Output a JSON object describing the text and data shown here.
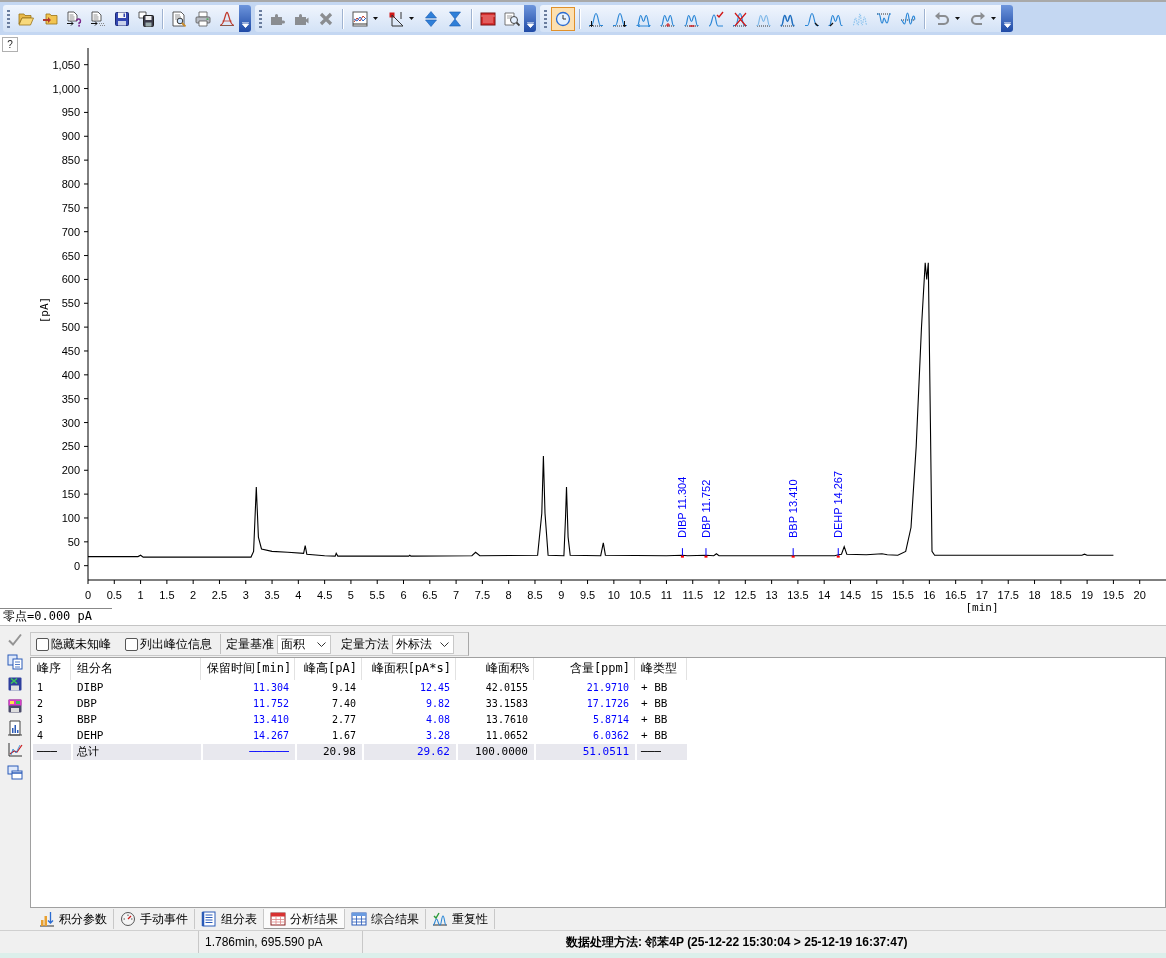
{
  "toolbar": {
    "groups": [
      {
        "sections": [
          {
            "buttons": [
              {
                "kind": "button",
                "disabled": false,
                "selected": false
              },
              {
                "kind": "button",
                "disabled": false,
                "selected": false
              },
              {
                "kind": "button",
                "disabled": false,
                "selected": false
              },
              {
                "kind": "button",
                "disabled": false,
                "selected": false
              },
              {
                "kind": "button",
                "disabled": false,
                "selected": false
              },
              {
                "kind": "button",
                "disabled": false,
                "selected": false
              }
            ]
          },
          {
            "buttons": [
              {
                "kind": "button",
                "disabled": false,
                "selected": false
              },
              {
                "kind": "button",
                "disabled": false,
                "selected": false
              },
              {
                "kind": "button",
                "disabled": false,
                "selected": false
              }
            ]
          }
        ]
      },
      {
        "sections": [
          {
            "buttons": [
              {
                "kind": "button",
                "disabled": true,
                "selected": false
              },
              {
                "kind": "button",
                "disabled": true,
                "selected": false
              },
              {
                "kind": "button",
                "disabled": true,
                "selected": false
              }
            ]
          },
          {
            "buttons": [
              {
                "kind": "split",
                "disabled": false,
                "selected": false
              },
              {
                "kind": "split",
                "disabled": false,
                "selected": false
              },
              {
                "kind": "button",
                "disabled": false,
                "selected": false
              },
              {
                "kind": "button",
                "disabled": false,
                "selected": false
              }
            ]
          },
          {
            "buttons": [
              {
                "kind": "button",
                "disabled": false,
                "selected": false
              },
              {
                "kind": "button",
                "disabled": false,
                "selected": false
              }
            ]
          }
        ]
      },
      {
        "sections": [
          {
            "buttons": [
              {
                "kind": "button",
                "disabled": false,
                "selected": true
              }
            ]
          },
          {
            "buttons": [
              {
                "kind": "button",
                "disabled": false,
                "selected": false
              },
              {
                "kind": "button",
                "disabled": false,
                "selected": false
              },
              {
                "kind": "button",
                "disabled": false,
                "selected": false
              },
              {
                "kind": "button",
                "disabled": false,
                "selected": false
              },
              {
                "kind": "button",
                "disabled": false,
                "selected": false
              },
              {
                "kind": "button",
                "disabled": false,
                "selected": false
              },
              {
                "kind": "button",
                "disabled": false,
                "selected": false
              },
              {
                "kind": "button",
                "disabled": false,
                "selected": false
              },
              {
                "kind": "button",
                "disabled": false,
                "selected": false
              },
              {
                "kind": "button",
                "disabled": false,
                "selected": false
              },
              {
                "kind": "button",
                "disabled": false,
                "selected": false
              },
              {
                "kind": "button",
                "disabled": false,
                "selected": false
              },
              {
                "kind": "button",
                "disabled": false,
                "selected": false
              },
              {
                "kind": "button",
                "disabled": false,
                "selected": false
              }
            ]
          },
          {
            "buttons": [
              {
                "kind": "split",
                "disabled": true,
                "selected": false
              },
              {
                "kind": "split",
                "disabled": true,
                "selected": false
              }
            ]
          }
        ]
      }
    ]
  },
  "chart_panel": {
    "help_button": "?",
    "zero_label": "零点=0.000 pA",
    "chart_data": {
      "type": "line",
      "xlabel": "[min]",
      "ylabel": "[pA]",
      "xlim": [
        0,
        20.5
      ],
      "ylim": [
        -30,
        1085
      ],
      "x": [
        0,
        0.5,
        0.95,
        1.0,
        1.05,
        1.1,
        2.0,
        3.1,
        3.15,
        3.2,
        3.24,
        3.3,
        3.5,
        3.8,
        4.1,
        4.13,
        4.16,
        4.5,
        4.7,
        4.72,
        4.75,
        6.1,
        6.12,
        6.14,
        7.3,
        7.37,
        7.45,
        8.55,
        8.63,
        8.66,
        8.69,
        8.75,
        9.05,
        9.08,
        9.1,
        9.13,
        9.17,
        9.75,
        9.8,
        9.84,
        11.0,
        11.304,
        11.4,
        11.752,
        11.9,
        11.95,
        12.0,
        13.41,
        14.2,
        14.27,
        14.33,
        14.38,
        14.43,
        14.8,
        15.1,
        15.2,
        15.4,
        15.55,
        15.65,
        15.75,
        15.85,
        15.92,
        15.95,
        15.98,
        16.02,
        16.05,
        16.1,
        18.9,
        18.95,
        19.0,
        19.5
      ],
      "values": [
        19,
        19,
        19,
        22,
        18,
        18,
        18,
        18,
        30,
        165,
        60,
        35,
        30,
        28,
        26,
        42,
        24,
        21,
        20,
        26,
        20,
        20,
        22,
        20,
        21,
        28,
        21,
        22,
        110,
        230,
        110,
        22,
        21,
        100,
        165,
        60,
        22,
        21,
        48,
        22,
        21,
        22,
        21,
        22,
        21,
        25,
        21,
        21,
        21,
        23,
        24,
        40,
        24,
        23,
        25,
        23,
        22,
        30,
        80,
        250,
        500,
        635,
        600,
        635,
        300,
        30,
        22,
        22,
        24,
        22,
        22
      ],
      "xticks": [
        0,
        0.5,
        1,
        1.5,
        2,
        2.5,
        3,
        3.5,
        4,
        4.5,
        5,
        5.5,
        6,
        6.5,
        7,
        7.5,
        8,
        8.5,
        9,
        9.5,
        10,
        10.5,
        11,
        11.5,
        12,
        12.5,
        13,
        13.5,
        14,
        14.5,
        15,
        15.5,
        16,
        16.5,
        17,
        17.5,
        18,
        18.5,
        19,
        19.5,
        20
      ],
      "yticks": [
        0,
        50,
        100,
        150,
        200,
        250,
        300,
        350,
        400,
        450,
        500,
        550,
        600,
        650,
        700,
        750,
        800,
        850,
        900,
        950,
        {
          "value": 1000,
          "label": "1,000"
        },
        {
          "value": 1050,
          "label": "1,050"
        }
      ],
      "annotations": [
        {
          "x": 11.304,
          "text": "DIBP 11.304"
        },
        {
          "x": 11.752,
          "text": "DBP 11.752"
        },
        {
          "x": 13.41,
          "text": "BBP 13.410"
        },
        {
          "x": 14.267,
          "text": "DEHP 14.267"
        }
      ]
    }
  },
  "side_toolbar": {
    "buttons": [
      {
        "disabled": true
      },
      {
        "disabled": false
      },
      {
        "disabled": false
      },
      {
        "disabled": false
      },
      {
        "disabled": false
      },
      {
        "disabled": false
      },
      {
        "disabled": false
      }
    ]
  },
  "filter_bar": {
    "checkboxes": [
      {
        "label": "隐藏未知峰",
        "checked": false
      },
      {
        "label": "列出峰位信息",
        "checked": false
      }
    ],
    "selects": [
      {
        "label": "定量基准",
        "value": "面积"
      },
      {
        "label": "定量方法",
        "value": "外标法"
      }
    ]
  },
  "table": {
    "columns": [
      {
        "label": "峰序",
        "kind": "index",
        "color": "#000000"
      },
      {
        "label": "组分名",
        "kind": "text",
        "color": "#000000"
      },
      {
        "label": "保留时间[min]",
        "kind": "number",
        "color": "#0000ff"
      },
      {
        "label": "峰高[pA]",
        "kind": "number",
        "color": "#000000"
      },
      {
        "label": "峰面积[pA*s]",
        "kind": "number",
        "color": "#0000ff"
      },
      {
        "label": "峰面积%",
        "kind": "number",
        "color": "#000000"
      },
      {
        "label": "含量[ppm]",
        "kind": "number",
        "color": "#0000ff"
      },
      {
        "label": "峰类型",
        "kind": "text",
        "color": "#000000"
      }
    ],
    "rows": [
      {
        "kind": "data",
        "cells": [
          "1",
          "DIBP",
          "11.304",
          "9.14",
          "12.45",
          "42.0155",
          "21.9710",
          "+ BB"
        ]
      },
      {
        "kind": "data",
        "cells": [
          "2",
          "DBP",
          "11.752",
          "7.40",
          "9.82",
          "33.1583",
          "17.1726",
          "+ BB"
        ]
      },
      {
        "kind": "data",
        "cells": [
          "3",
          "BBP",
          "13.410",
          "2.77",
          "4.08",
          "13.7610",
          "5.8714",
          "+ BB"
        ]
      },
      {
        "kind": "data",
        "cells": [
          "4",
          "DEHP",
          "14.267",
          "1.67",
          "3.28",
          "11.0652",
          "6.0362",
          "+ BB"
        ]
      },
      {
        "kind": "total",
        "cells": [
          "───",
          "总计",
          "──────",
          "20.98",
          "29.62",
          "100.0000",
          "51.0511",
          "───"
        ]
      }
    ]
  },
  "tabs": [
    {
      "label": "积分参数",
      "selected": false
    },
    {
      "label": "手动事件",
      "selected": false
    },
    {
      "label": "组分表",
      "selected": false
    },
    {
      "label": "分析结果",
      "selected": true
    },
    {
      "label": "综合结果",
      "selected": false
    },
    {
      "label": "重复性",
      "selected": false
    }
  ],
  "status_bar": {
    "cursor": "1.786min, 695.590 pA",
    "method": "数据处理方法: 邻苯4P (25-12-22 15:30:04 > 25-12-19 16:37:47)"
  }
}
